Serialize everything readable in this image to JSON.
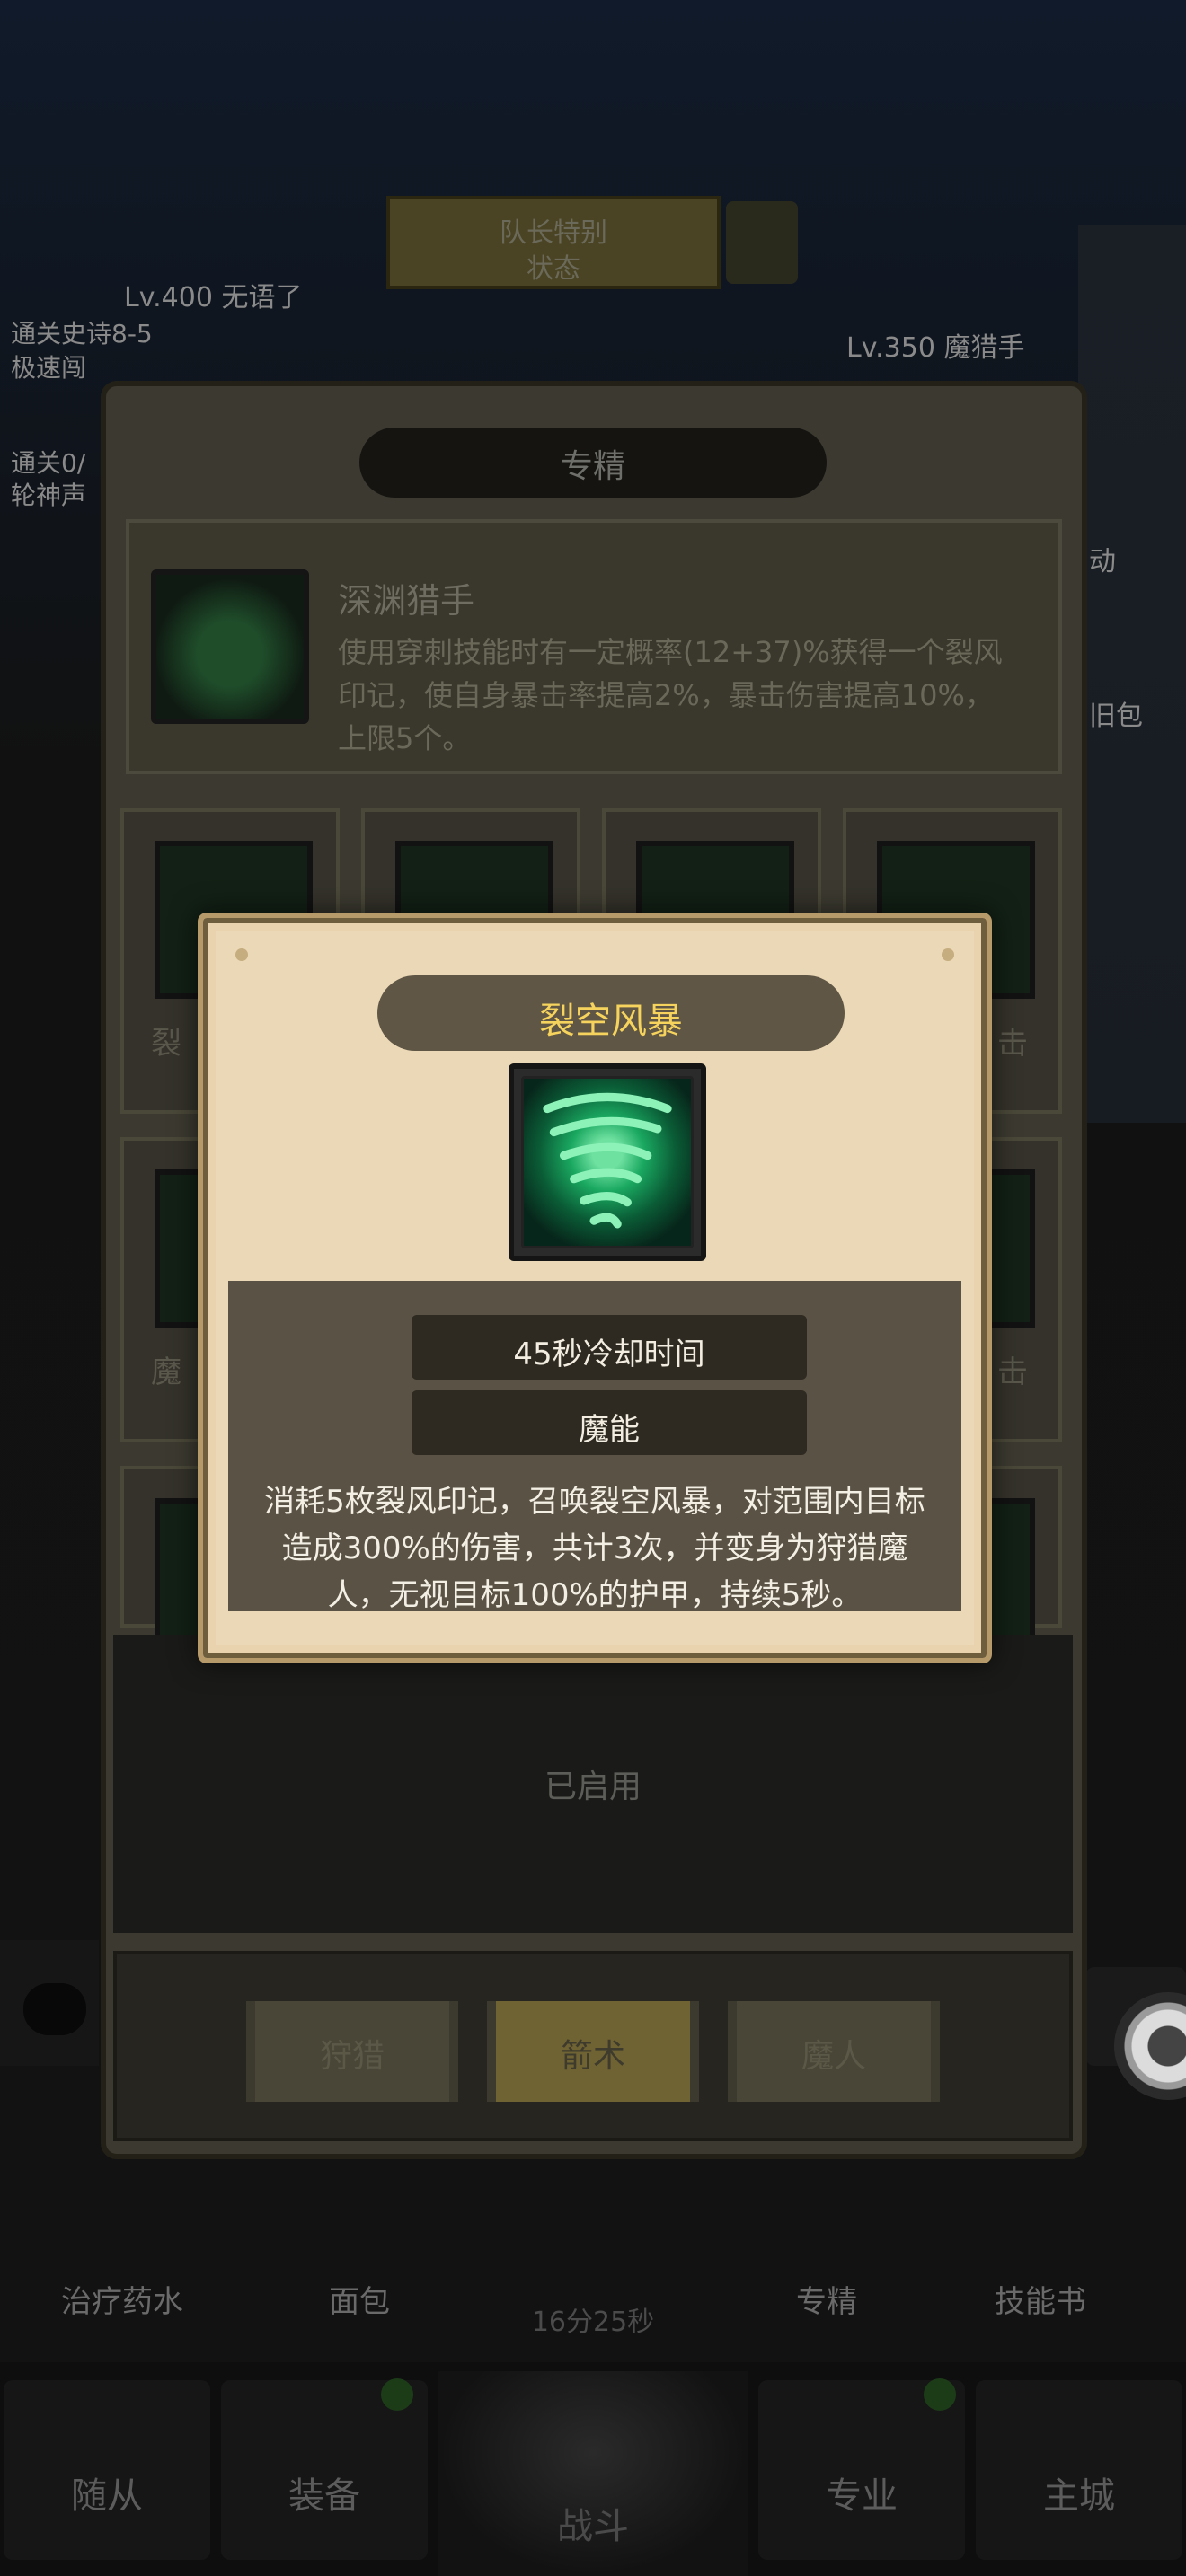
{
  "background": {
    "top_banner_line1": "队长特别",
    "top_banner_line2": "状态",
    "left_player": "Lv.400 无语了",
    "right_player": "Lv.350 魔猎手",
    "left_info_1": "通关史诗8-5",
    "left_info_2": "极速闯",
    "left_info_3": "通关0/",
    "left_info_4": "轮神声",
    "right_info_1": "动",
    "right_info_2": "旧包"
  },
  "bottom_items": [
    {
      "label": "治疗药水"
    },
    {
      "label": "面包"
    },
    {
      "label": "专精"
    },
    {
      "label": "技能书"
    }
  ],
  "bottom_timer": "16分25秒",
  "nav": [
    {
      "label": "随从"
    },
    {
      "label": "装备"
    },
    {
      "label": "战斗"
    },
    {
      "label": "专业"
    },
    {
      "label": "主城"
    }
  ],
  "spec_panel": {
    "title": "专精",
    "card": {
      "name": "深渊猎手",
      "description": "使用穿刺技能时有一定概率(12+37)%获得一个裂风印记，使自身暴击率提高2%，暴击伤害提高10%，上限5个。"
    },
    "slot_labels": {
      "row1_left": "裂",
      "row1_right": "击",
      "row2_left": "魔",
      "row2_right": "击"
    },
    "enabled_text": "已启用",
    "tabs": [
      {
        "label": "狩猎",
        "active": false
      },
      {
        "label": "箭术",
        "active": true
      },
      {
        "label": "魔人",
        "active": false
      }
    ]
  },
  "popup": {
    "title": "裂空风暴",
    "icon": "tornado-icon",
    "cooldown": "45秒冷却时间",
    "cost_type": "魔能",
    "description": "消耗5枚裂风印记，召唤裂空风暴，对范围内目标造成300%的伤害，共计3次，并变身为狩猎魔人，无视目标100%的护甲，持续5秒。"
  },
  "colors": {
    "title_gold": "#f6d35c",
    "parchment": "#ebd8b6",
    "dark_panel": "#5a5244",
    "stat_bar": "#2e2a22"
  }
}
